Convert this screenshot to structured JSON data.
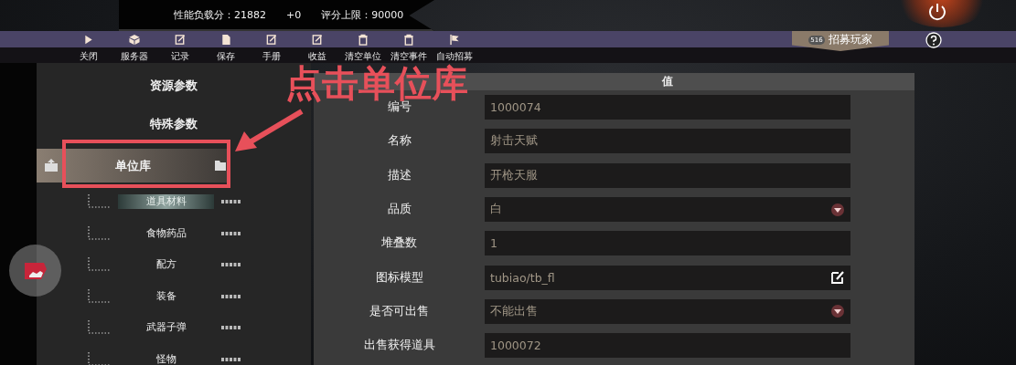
{
  "score_banner": {
    "load_label": "性能负载分：21882",
    "delta": "+0",
    "limit_label": "评分上限：90000"
  },
  "toolbar": [
    {
      "label": "关闭"
    },
    {
      "label": "服务器"
    },
    {
      "label": "记录"
    },
    {
      "label": "保存"
    },
    {
      "label": "手册"
    },
    {
      "label": "收益"
    },
    {
      "label": "清空单位"
    },
    {
      "label": "清空事件"
    },
    {
      "label": "自动招募"
    }
  ],
  "recruit_button": {
    "label": "招募玩家",
    "badge": "516"
  },
  "sidebar": {
    "items": [
      {
        "label": "资源参数",
        "selected": false
      },
      {
        "label": "特殊参数",
        "selected": false
      },
      {
        "label": "单位库",
        "selected": true,
        "children": [
          {
            "label": "道具材料",
            "selected": true
          },
          {
            "label": "食物药品",
            "selected": false
          },
          {
            "label": "配方",
            "selected": false
          },
          {
            "label": "装备",
            "selected": false
          },
          {
            "label": "武器子弹",
            "selected": false
          },
          {
            "label": "怪物",
            "selected": false
          }
        ]
      }
    ]
  },
  "table": {
    "columns": [
      "值"
    ],
    "rows": [
      {
        "label": "编号",
        "value": "1000074",
        "kind": "text"
      },
      {
        "label": "名称",
        "value": "射击天赋",
        "kind": "text"
      },
      {
        "label": "描述",
        "value": "开枪天服",
        "kind": "text"
      },
      {
        "label": "品质",
        "value": "白",
        "kind": "select"
      },
      {
        "label": "堆叠数",
        "value": "1",
        "kind": "text"
      },
      {
        "label": "图标模型",
        "value": "tubiao/tb_fl",
        "kind": "edit"
      },
      {
        "label": "是否可出售",
        "value": "不能出售",
        "kind": "select"
      },
      {
        "label": "出售获得道具",
        "value": "1000072",
        "kind": "text"
      }
    ]
  },
  "annotation": {
    "text": "点击单位库"
  }
}
